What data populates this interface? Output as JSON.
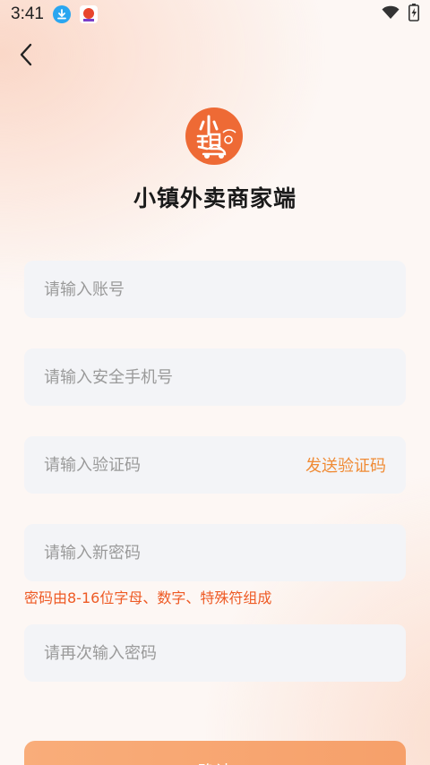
{
  "status_bar": {
    "time": "3:41"
  },
  "header": {
    "back_icon": "chevron-left-icon"
  },
  "brand": {
    "logo_color": "#ee6a35",
    "title": "小镇外卖商家端"
  },
  "form": {
    "account_placeholder": "请输入账号",
    "phone_placeholder": "请输入安全手机号",
    "code_placeholder": "请输入验证码",
    "send_code_label": "发送验证码",
    "new_password_placeholder": "请输入新密码",
    "password_hint": "密码由8-16位字母、数字、特殊符组成",
    "confirm_password_placeholder": "请再次输入密码",
    "submit_label": "确认"
  },
  "colors": {
    "accent": "#f08b35",
    "hint": "#ee5a24",
    "field_bg": "#f3f4f7"
  }
}
